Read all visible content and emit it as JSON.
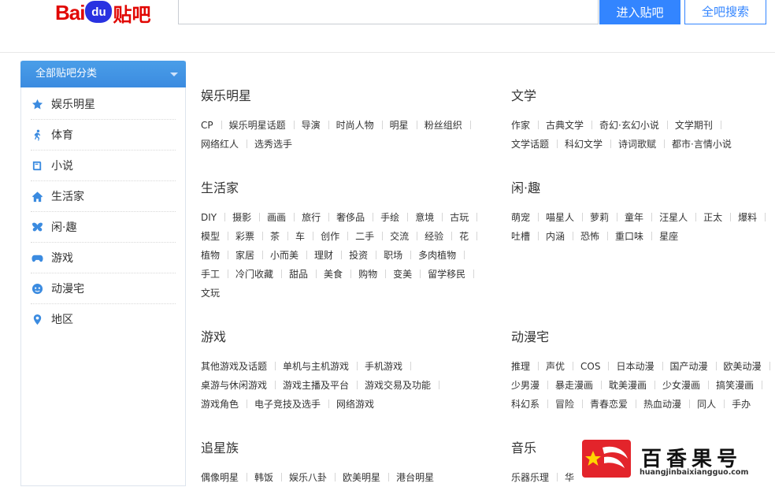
{
  "header": {
    "logo_bai": "Bai",
    "logo_du": "du",
    "logo_tieba": "贴吧",
    "search_value": "",
    "enter_button": "进入贴吧",
    "all_search_button": "全吧搜索"
  },
  "sidebar": {
    "title": "全部贴吧分类",
    "items": [
      {
        "label": "娱乐明星",
        "icon": "star-icon"
      },
      {
        "label": "体育",
        "icon": "runner-icon"
      },
      {
        "label": "小说",
        "icon": "book-icon"
      },
      {
        "label": "生活家",
        "icon": "home-icon"
      },
      {
        "label": "闲·趣",
        "icon": "butterfly-icon"
      },
      {
        "label": "游戏",
        "icon": "gamepad-icon"
      },
      {
        "label": "动漫宅",
        "icon": "anime-icon"
      },
      {
        "label": "地区",
        "icon": "location-pin-icon"
      }
    ]
  },
  "categories": {
    "entertainment": {
      "title": "娱乐明星",
      "tags": [
        "CP",
        "娱乐明星话题",
        "导演",
        "时尚人物",
        "明星",
        "粉丝组织",
        "网络红人",
        "选秀选手"
      ]
    },
    "literature": {
      "title": "文学",
      "tags": [
        "作家",
        "古典文学",
        "奇幻·玄幻小说",
        "文学期刊",
        "文学话题",
        "科幻文学",
        "诗词歌赋",
        "都市·言情小说"
      ]
    },
    "life": {
      "title": "生活家",
      "tags": [
        "DIY",
        "摄影",
        "画画",
        "旅行",
        "奢侈品",
        "手绘",
        "意境",
        "古玩",
        "模型",
        "彩票",
        "茶",
        "车",
        "创作",
        "二手",
        "交流",
        "经验",
        "花",
        "植物",
        "家居",
        "小而美",
        "理财",
        "投资",
        "职场",
        "多肉植物",
        "手工",
        "冷门收藏",
        "甜品",
        "美食",
        "购物",
        "变美",
        "留学移民",
        "文玩"
      ]
    },
    "leisure": {
      "title": "闲·趣",
      "tags": [
        "萌宠",
        "喵星人",
        "萝莉",
        "童年",
        "汪星人",
        "正太",
        "爆料",
        "吐槽",
        "内涵",
        "恐怖",
        "重口味",
        "星座"
      ]
    },
    "games": {
      "title": "游戏",
      "tags": [
        "其他游戏及话题",
        "单机与主机游戏",
        "手机游戏",
        "桌游与休闲游戏",
        "游戏主播及平台",
        "游戏交易及功能",
        "游戏角色",
        "电子竞技及选手",
        "网络游戏"
      ]
    },
    "anime": {
      "title": "动漫宅",
      "tags": [
        "推理",
        "声优",
        "COS",
        "日本动漫",
        "国产动漫",
        "欧美动漫",
        "少男漫",
        "暴走漫画",
        "耽美漫画",
        "少女漫画",
        "搞笑漫画",
        "科幻系",
        "冒险",
        "青春恋爱",
        "热血动漫",
        "同人",
        "手办"
      ]
    },
    "star_chasers": {
      "title": "追星族",
      "tags": [
        "偶像明星",
        "韩饭",
        "娱乐八卦",
        "欧美明星",
        "港台明星"
      ]
    },
    "music": {
      "title": "音乐",
      "tags": [
        "乐器乐理",
        "华"
      ]
    }
  },
  "watermark": {
    "name": "百香果号",
    "url": "huangjinbaixiangguo.com"
  },
  "colors": {
    "accent": "#3385ff",
    "logo_red": "#e10602",
    "logo_blue": "#2932e1"
  }
}
